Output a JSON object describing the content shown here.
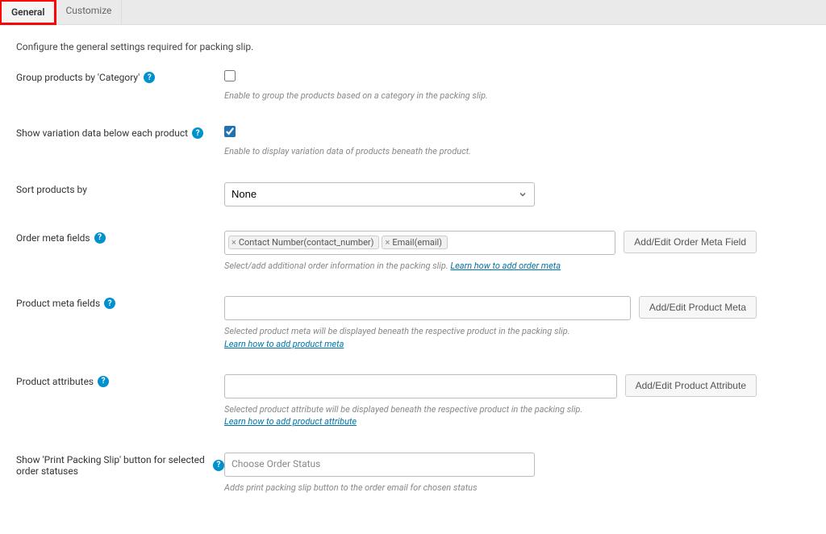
{
  "tabs": {
    "general": "General",
    "customize": "Customize"
  },
  "intro": "Configure the general settings required for packing slip.",
  "rows": {
    "group_category": {
      "label": "Group products by 'Category'",
      "desc": "Enable to group the products based on a category in the packing slip."
    },
    "variation": {
      "label": "Show variation data below each product",
      "desc": "Enable to display variation data of products beneath the product."
    },
    "sort": {
      "label": "Sort products by",
      "selected": "None"
    },
    "order_meta": {
      "label": "Order meta fields",
      "tags": [
        "Contact Number(contact_number)",
        "Email(email)"
      ],
      "desc_pre": "Select/add additional order information in the packing slip. ",
      "desc_link": "Learn how to add order meta",
      "button": "Add/Edit Order Meta Field"
    },
    "product_meta": {
      "label": "Product meta fields",
      "desc_pre": "Selected product meta will be displayed beneath the respective product in the packing slip.",
      "desc_link": "Learn how to add product meta",
      "button": "Add/Edit Product Meta"
    },
    "product_attr": {
      "label": "Product attributes",
      "desc_pre": "Selected product attribute will be displayed beneath the respective product in the packing slip.",
      "desc_link": "Learn how to add product attribute",
      "button": "Add/Edit Product Attribute"
    },
    "print_button": {
      "label": "Show 'Print Packing Slip' button for selected order statuses",
      "placeholder": "Choose Order Status",
      "desc": "Adds print packing slip button to the order email for chosen status"
    }
  }
}
